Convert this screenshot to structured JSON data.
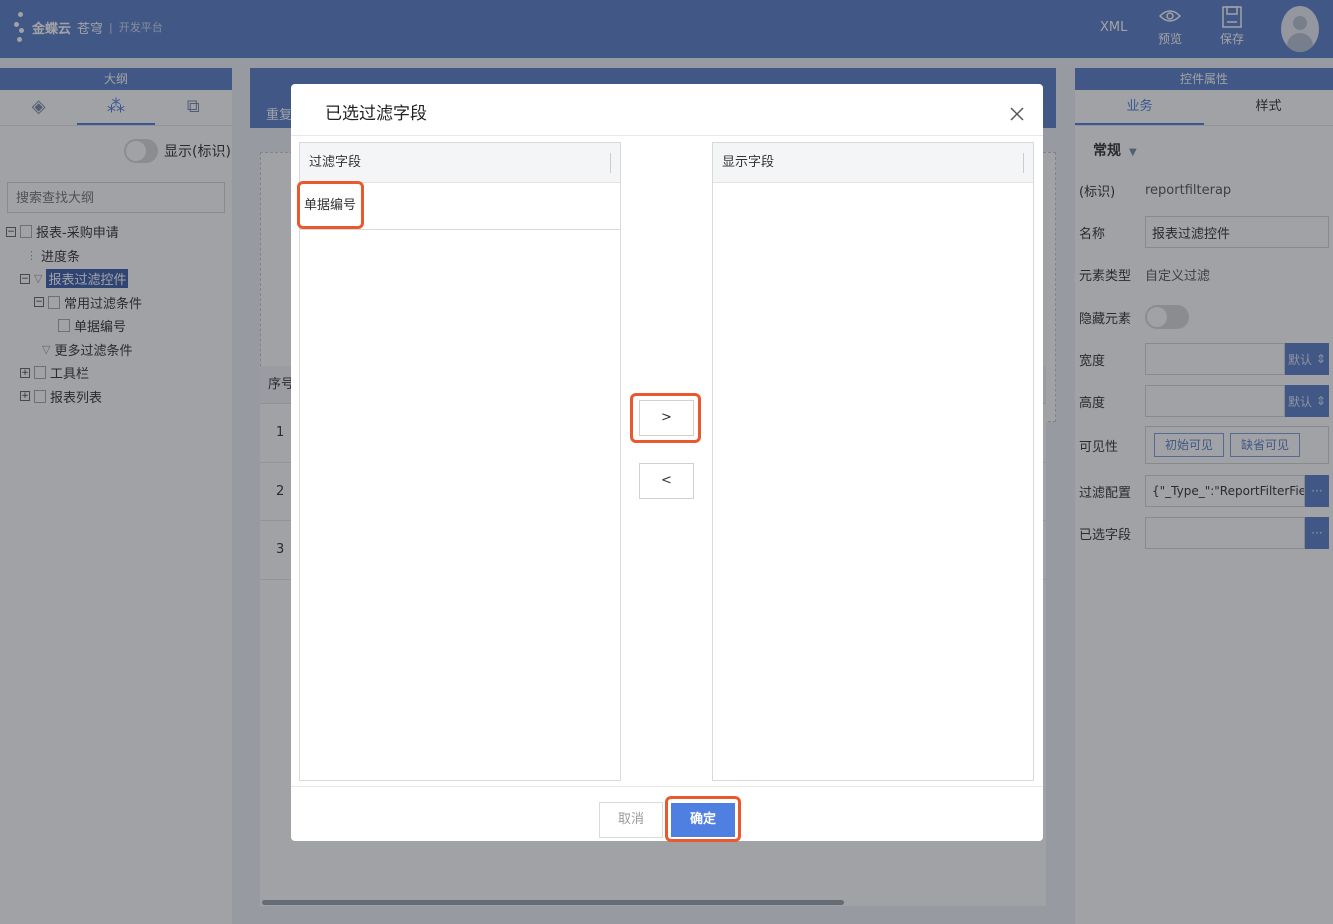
{
  "header": {
    "logo_brand": "金蝶云",
    "logo_product": "苍穹",
    "logo_subtitle": "开发平台",
    "xml_label": "XML",
    "preview_label": "预览",
    "save_label": "保存"
  },
  "outline": {
    "title": "大纲",
    "show_id_label": "显示(标识)",
    "search_placeholder": "搜索查找大纲",
    "tree": [
      "报表-采购申请",
      "进度条",
      "报表过滤控件",
      "常用过滤条件",
      "单据编号",
      "更多过滤条件",
      "工具栏",
      "报表列表"
    ]
  },
  "canvas": {
    "toolbar_repeat_label": "重复",
    "grid_header": "序号",
    "grid_rows": [
      "1",
      "2",
      "3"
    ]
  },
  "properties": {
    "title": "控件属性",
    "tab_business": "业务",
    "tab_style": "样式",
    "section": "常规",
    "id_label": "(标识)",
    "id_value": "reportfilterap",
    "name_label": "名称",
    "name_value": "报表过滤控件",
    "type_label": "元素类型",
    "type_value": "自定义过滤",
    "hidden_label": "隐藏元素",
    "hidden_on": false,
    "width_label": "宽度",
    "width_default": "默认",
    "height_label": "高度",
    "height_default": "默认",
    "visibility_label": "可见性",
    "vis_initial": "初始可见",
    "vis_default": "缺省可见",
    "filter_config_label": "过滤配置",
    "filter_config_value": "{\"_Type_\":\"ReportFilterField(",
    "selected_fields_label": "已选字段",
    "more_btn": "···"
  },
  "modal": {
    "title": "已选过滤字段",
    "left_header": "过滤字段",
    "left_items": [
      "单据编号"
    ],
    "right_header": "显示字段",
    "move_right": ">",
    "move_left": "<",
    "cancel": "取消",
    "ok": "确定",
    "highlight_color": "#e85a2e",
    "primary_color": "#4f7fe0"
  }
}
